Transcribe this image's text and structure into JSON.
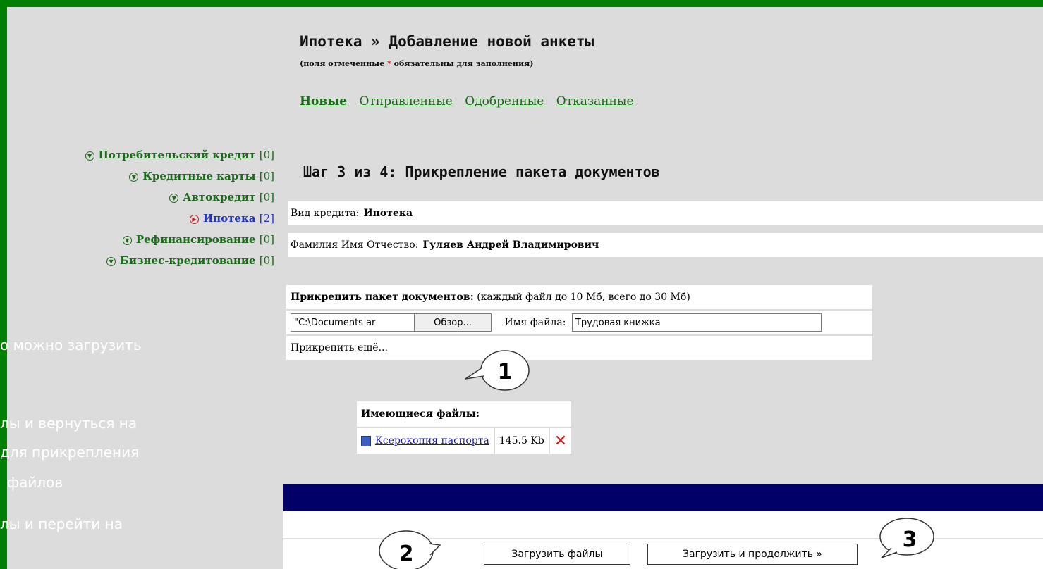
{
  "header": {
    "title": "Ипотека » Добавление новой анкеты",
    "note_before": "(поля отмеченные",
    "note_star": "*",
    "note_after": "обязательны для заполнения)"
  },
  "tabs": [
    "Новые",
    "Отправленные",
    "Одобренные",
    "Отказанные"
  ],
  "sidebar": {
    "items": [
      {
        "label": "Потребительский кредит",
        "count": "[0]"
      },
      {
        "label": "Кредитные карты",
        "count": "[0]"
      },
      {
        "label": "Автокредит",
        "count": "[0]"
      },
      {
        "label": "Ипотека",
        "count": "[2]"
      },
      {
        "label": "Рефинансирование",
        "count": "[0]"
      },
      {
        "label": "Бизнес-кредитование",
        "count": "[0]"
      }
    ]
  },
  "step": "Шаг 3 из 4: Прикрепление пакета документов",
  "info": {
    "credit_label": "Вид кредита:",
    "credit_value": "Ипотека",
    "fio_label": "Фамилия Имя Отчество:",
    "fio_value": "Гуляев Андрей Владимирович"
  },
  "attach": {
    "heading": "Прикрепить пакет документов:",
    "hint": "(каждый файл до 10 Мб, всего до 30 Мб)",
    "path_value": "\"C:\\Documents ar",
    "browse_label": "Обзор...",
    "name_label": "Имя файла:",
    "name_value": "Трудовая книжка",
    "more_link": "Прикрепить ещё..."
  },
  "files": {
    "heading": "Имеющиеся файлы:",
    "items": [
      {
        "name": "Ксерокопия паспорта",
        "size": "145.5 Kb"
      }
    ]
  },
  "buttons": {
    "upload": "Загрузить файлы",
    "upload_continue": "Загрузить и продолжить »"
  },
  "callouts": [
    "1",
    "2",
    "3"
  ],
  "background_text": [
    "о можно загрузить",
    "лы и вернуться на",
    "для прикрепления",
    "файлов",
    "лы и перейти на"
  ]
}
